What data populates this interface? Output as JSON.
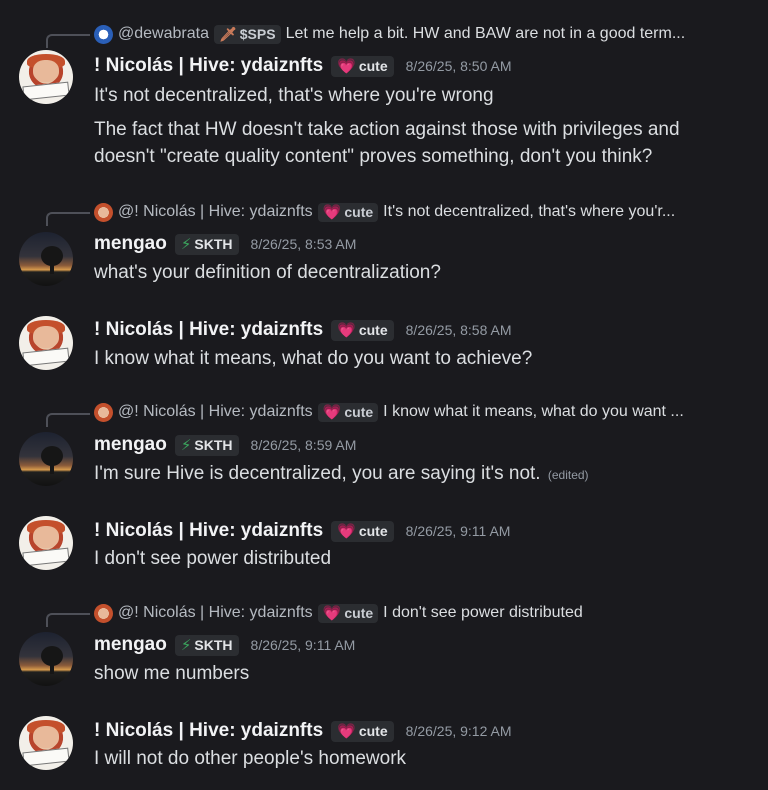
{
  "messages": [
    {
      "reply": {
        "name": "@dewabrata",
        "tag_label": "$SPS",
        "tag_icon": "sword-icon",
        "text": "Let me help a bit. HW and BAW are not in a good term..."
      },
      "author": "! Nicolás | Hive: ydaiznfts",
      "tag_label": "cute",
      "tag_icon": "heart-icon",
      "timestamp": "8/26/25, 8:50 AM",
      "lines": [
        "It's not decentralized, that's where you're wrong"
      ],
      "extra": "The fact that HW doesn't take action against those with privileges and doesn't \"create quality content\" proves something, don't you think?"
    },
    {
      "reply": {
        "name": "@! Nicolás | Hive: ydaiznfts",
        "tag_label": "cute",
        "tag_icon": "heart-icon",
        "text": "It's not decentralized, that's where you'r..."
      },
      "author": "mengao",
      "tag_label": "SKTH",
      "tag_icon": "lightning-icon",
      "timestamp": "8/26/25, 8:53 AM",
      "lines": [
        "what's your definition of decentralization?"
      ]
    },
    {
      "author": "! Nicolás | Hive: ydaiznfts",
      "tag_label": "cute",
      "tag_icon": "heart-icon",
      "timestamp": "8/26/25, 8:58 AM",
      "lines": [
        "I know what it means, what do you want to achieve?"
      ]
    },
    {
      "reply": {
        "name": "@! Nicolás | Hive: ydaiznfts",
        "tag_label": "cute",
        "tag_icon": "heart-icon",
        "text": "I know what it means, what do you want ..."
      },
      "author": "mengao",
      "tag_label": "SKTH",
      "tag_icon": "lightning-icon",
      "timestamp": "8/26/25, 8:59 AM",
      "lines": [
        "I'm sure Hive is decentralized, you are saying it's not."
      ],
      "edited": "(edited)"
    },
    {
      "author": "! Nicolás | Hive: ydaiznfts",
      "tag_label": "cute",
      "tag_icon": "heart-icon",
      "timestamp": "8/26/25, 9:11 AM",
      "lines": [
        "I don't see power distributed"
      ]
    },
    {
      "reply": {
        "name": "@! Nicolás | Hive: ydaiznfts",
        "tag_label": "cute",
        "tag_icon": "heart-icon",
        "text": "I don't see power distributed"
      },
      "author": "mengao",
      "tag_label": "SKTH",
      "tag_icon": "lightning-icon",
      "timestamp": "8/26/25, 9:11 AM",
      "lines": [
        "show me numbers"
      ]
    },
    {
      "author": "! Nicolás | Hive: ydaiznfts",
      "tag_label": "cute",
      "tag_icon": "heart-icon",
      "timestamp": "8/26/25, 9:12 AM",
      "lines": [
        "I will not do other people's homework"
      ]
    }
  ],
  "colors": {
    "background": "#1a1a1e",
    "text": "#dbdee1",
    "muted": "#949ba4",
    "heart": "#f47fb5",
    "bolt": "#3ba55d"
  }
}
